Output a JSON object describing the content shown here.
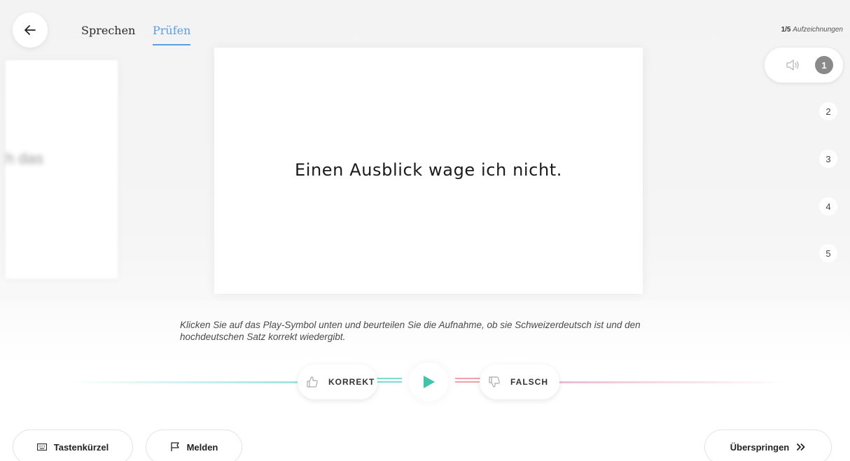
{
  "nav": {
    "tabs": [
      {
        "label": "Sprechen",
        "active": false
      },
      {
        "label": "Prüfen",
        "active": true
      }
    ]
  },
  "recordings": {
    "current": "1/5",
    "label": "Aufzeichnungen",
    "numbers": [
      "1",
      "2",
      "3",
      "4",
      "5"
    ],
    "active_index": 0
  },
  "side_card": {
    "text": "h das"
  },
  "card": {
    "sentence": "Einen Ausblick wage ich nicht."
  },
  "instructions": "Klicken Sie auf das Play-Symbol unten und beurteilen Sie die Aufnahme, ob sie Schweizerdeutsch ist und den hochdeutschen Satz korrekt wiedergibt.",
  "vote": {
    "correct_label": "KORREKT",
    "wrong_label": "FALSCH"
  },
  "footer": {
    "shortcuts_label": "Tastenkürzel",
    "report_label": "Melden",
    "skip_label": "Überspringen"
  },
  "colors": {
    "accent_blue": "#5c9ce6",
    "play_green": "#3fc5ab",
    "correct_line": "#7fdcd0",
    "wrong_line": "#f4a0a8"
  },
  "icons": [
    "back-arrow-icon",
    "speaker-icon",
    "thumbs-up-icon",
    "thumbs-down-icon",
    "play-icon",
    "keyboard-icon",
    "flag-icon",
    "double-chevron-right-icon"
  ]
}
